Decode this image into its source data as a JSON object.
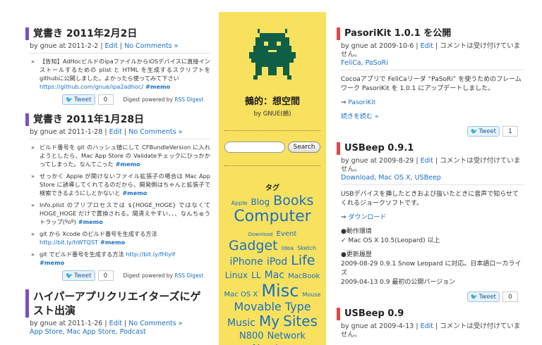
{
  "left": {
    "posts": [
      {
        "title": "覚書き 2011年2月2日",
        "by": "by gnue at 2011-2-2 | ",
        "edit": "Edit",
        "sep": " | ",
        "comments": "No Comments »",
        "items": [
          {
            "text": "【告知】AdHocビルドのipaファイルからiOSデバイスに直接インストールするための plist と HTML を生成するスクリプトをgithubに公開しました。よかったら使ってみて下さい",
            "link": "https://github.com/gnue/ipa2adhoc/",
            "tag": " #memo"
          }
        ],
        "tweet": "Tweet",
        "count": "0",
        "digest_pre": "Digest powered by ",
        "digest_link": "RSS Digest"
      },
      {
        "title": "覚書き 2011年1月28日",
        "by": "by gnue at 2011-1-28 | ",
        "edit": "Edit",
        "sep": " | ",
        "comments": "No Comments »",
        "items": [
          {
            "text": "ビルド番号を git のハッシュ値にして CFBundleVersion に入れようとしたら、Mac App Store の Validateチェックにひっかかってしまった。なんてこった",
            "tag": " #memo"
          },
          {
            "text": "せっかく Apple が関けないファイル拡張子の場合は Mac App Store に誘導してくれてるのだから、開発側はちゃんと拡張子で検索できるようにしとかないと",
            "tag": " #memo"
          },
          {
            "text": "Info.plist のプリプロセスでは ${HOGE_HOGE} ではなくて HOGE_HOGE だけで置換される。間違えやすい、、、なんちゅうトラップ(ºoº)",
            "tag": " #memo"
          },
          {
            "text": "git から Xcode のビルド番号を生成する方法",
            "link": "http://bit.ly/hWTQST",
            "tag": " #memo"
          },
          {
            "text": "git でビルド番号を生成する方法 ",
            "link": "http://bit.ly/fHIylf",
            "tag": " #memo"
          }
        ],
        "tweet": "Tweet",
        "count": "0",
        "digest_pre": "Digest powered by ",
        "digest_link": "RSS Digest"
      },
      {
        "title": "ハイパーアプリクリエイターズにゲスト出演",
        "by": "by gnue at 2011-1-26 | ",
        "edit": "Edit",
        "sep": " | ",
        "comments": "No Comments »",
        "cats": "App Store, Mac App Store, Podcast"
      }
    ]
  },
  "mid": {
    "site_title": "鵺的：想空間",
    "author": "by GNUE(鵺)",
    "search_button": "Search",
    "search_placeholder": "",
    "tag_heading": "タグ",
    "tags": [
      {
        "t": "Apple",
        "s": 8
      },
      {
        "t": "Blog",
        "s": 12
      },
      {
        "t": "Books",
        "s": 19
      },
      {
        "t": "Computer",
        "s": 22
      },
      {
        "t": "Download",
        "s": 7
      },
      {
        "t": "Event",
        "s": 10
      },
      {
        "t": "Gadget",
        "s": 19
      },
      {
        "t": "Idea",
        "s": 8
      },
      {
        "t": "Sketch",
        "s": 8
      },
      {
        "t": "iPhone",
        "s": 14
      },
      {
        "t": "iPod",
        "s": 14
      },
      {
        "t": "Life",
        "s": 19
      },
      {
        "t": "Linux",
        "s": 12
      },
      {
        "t": "LL",
        "s": 12
      },
      {
        "t": "Mac",
        "s": 14
      },
      {
        "t": "MacBook",
        "s": 10
      },
      {
        "t": "Mac OS X",
        "s": 10
      },
      {
        "t": "Misc",
        "s": 24
      },
      {
        "t": "Mouse",
        "s": 8
      },
      {
        "t": "Movable",
        "s": 16
      },
      {
        "t": "Type",
        "s": 16
      },
      {
        "t": "Music",
        "s": 14
      },
      {
        "t": "My",
        "s": 20
      },
      {
        "t": "Sites",
        "s": 20
      },
      {
        "t": "N800",
        "s": 13
      },
      {
        "t": "Network",
        "s": 13
      },
      {
        "t": "Newton",
        "s": 15
      }
    ]
  },
  "right": {
    "p1": {
      "title": "PasoriKit 1.0.1 を公開",
      "by": "by gnue at 2009-10-6 | ",
      "edit": "Edit",
      "sep": " | ",
      "comments": "コメントは受け付けていません。",
      "cats": "FeliCa, PaSoRi",
      "body": "Cocoaアプリで FeliCaリーダ “PaSoRi” を使うためのフレームワーク PasoriKit を 1.0.1 にアップデートしました。",
      "arrow": "⇒ ",
      "link": "PasoriKit",
      "more": "続きを読む »",
      "tweet": "Tweet",
      "count": "1"
    },
    "p2": {
      "title": "USBeep 0.9.1",
      "by": "by gnue at 2009-8-29 | ",
      "edit": "Edit",
      "sep": " | ",
      "comments": "コメントは受け付けていません。",
      "cats": "Download, Mac OS X, USBeep",
      "body": "USBデバイスを挿したときおよび抜いたときに音声で知らせてくれるジョークソフトです。",
      "arrow": "⇒ ",
      "link": "ダウンロード",
      "env_h": "●動作環境",
      "env": "✓ Mac OS X 10.5(Leopard) 以上",
      "hist_h": "●更新履歴",
      "h1": "2009-08-29 0.9.1 Snow Leopard に対応。日本語ローカライズ",
      "h2": "2009-04-13 0.9 最初の公開バージョン",
      "tweet": "Tweet",
      "count": "0"
    },
    "p3": {
      "title": "USBeep 0.9",
      "by": "by gnue at 2009-4-13 | ",
      "edit": "Edit",
      "sep": " | ",
      "comments": "コメントは受け付けていません。"
    }
  },
  "colors": {
    "accent_left": "#7b4fc8",
    "accent_right": "#e04848",
    "sidebar_bg": "#f7e15e",
    "link": "#1a6fc4",
    "mascot": "#0f5e46"
  }
}
